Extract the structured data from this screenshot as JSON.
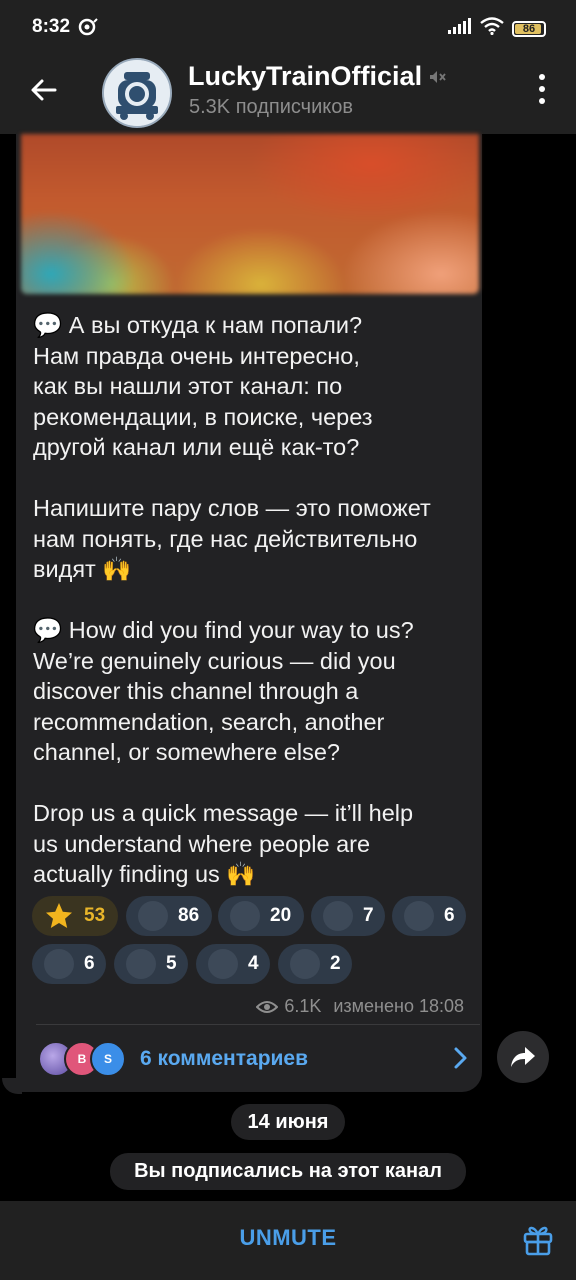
{
  "status": {
    "time": "8:32",
    "battery": "86"
  },
  "header": {
    "title": "LuckyTrainOfficial",
    "subtitle": "5.3K подписчиков"
  },
  "post": {
    "paragraphs": [
      {
        "emoji": "💬",
        "text": "А вы откуда к нам попали?\nНам правда очень интересно,\nкак вы нашли этот канал: по\nрекомендации, в поиске, через\nдругой канал или ещё как-то?"
      },
      {
        "emoji": "",
        "text": "Напишите пару слов — это поможет\nнам понять, где нас действительно\nвидят",
        "trail_emoji": "🙌"
      },
      {
        "emoji": "💬",
        "text": "How did you find your way to us?\nWe’re genuinely curious — did you\ndiscover this channel through a\nrecommendation, search, another\nchannel, or somewhere else?"
      },
      {
        "emoji": "",
        "text": "Drop us a quick message — it’ll help\nus understand where people are\nactually finding us",
        "trail_emoji": "🙌"
      }
    ],
    "reactions": [
      {
        "icon": "star-icon",
        "count": "53",
        "selected": true
      },
      {
        "icon": "heart-icon",
        "count": "86"
      },
      {
        "icon": "thumbs-up-icon",
        "count": "20"
      },
      {
        "icon": "clap-icon",
        "count": "7"
      },
      {
        "icon": "fire-icon",
        "count": "6"
      },
      {
        "icon": "party-icon",
        "count": "6"
      },
      {
        "icon": "trophy-icon",
        "count": "5"
      },
      {
        "icon": "money-icon",
        "count": "4"
      },
      {
        "icon": "moneybag-icon",
        "count": "2"
      }
    ],
    "views": "6.1K",
    "edited": "изменено 18:08",
    "comments_label": "6 комментариев",
    "comment_avatars": [
      "",
      "B",
      "S"
    ]
  },
  "date_pill": "14 июня",
  "service_message": "Вы подписались на этот канал",
  "bottom": {
    "unmute": "UNMUTE"
  },
  "colors": {
    "accent": "#4a9ee8",
    "link": "#5aa9f0",
    "bubble": "#222224",
    "bar": "#212121"
  }
}
